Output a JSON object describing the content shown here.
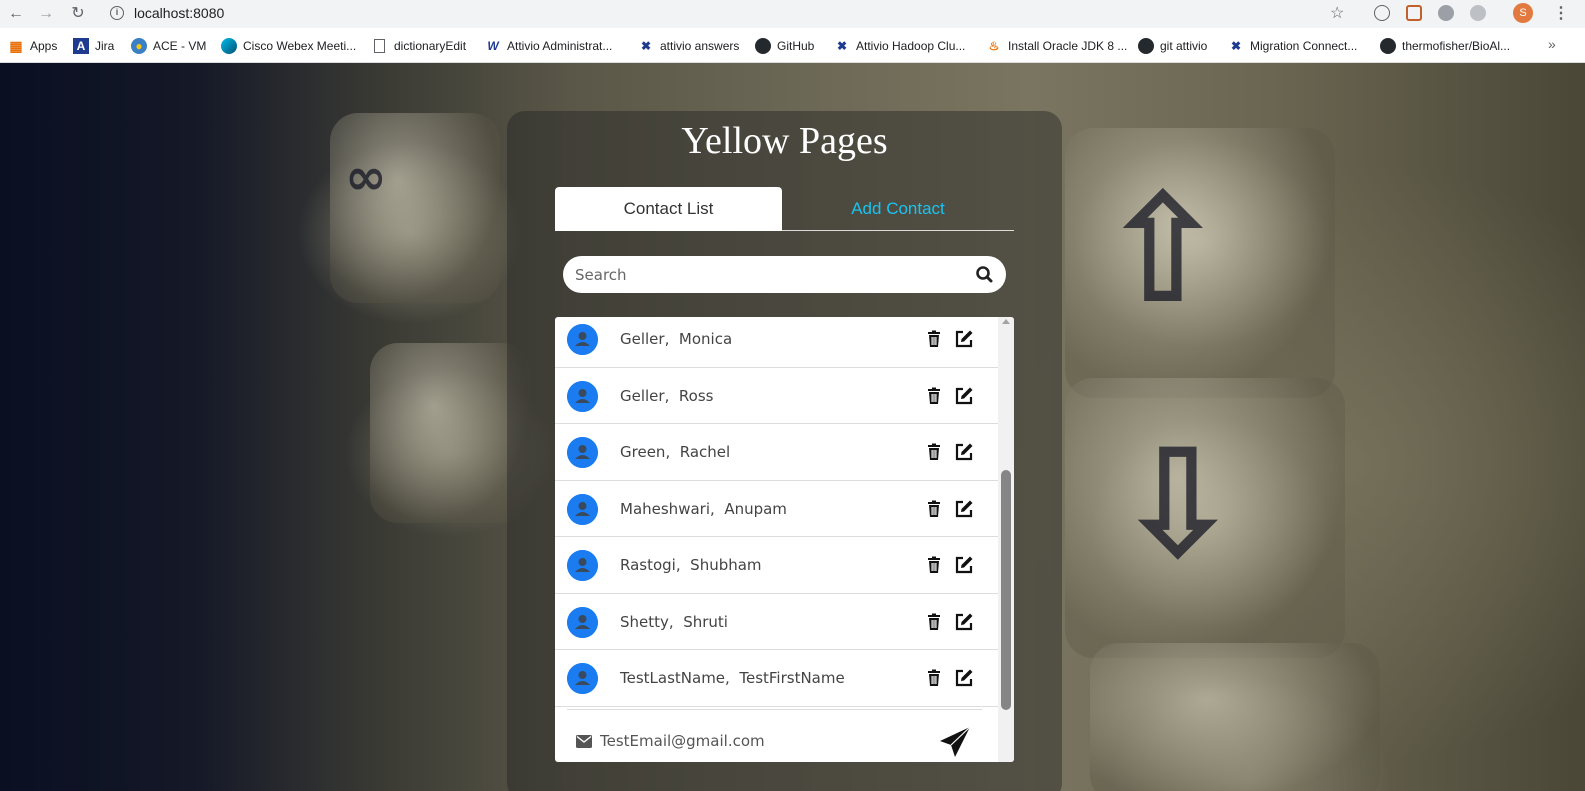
{
  "browser": {
    "url": "localhost:8080",
    "profile_initial": "S",
    "bookmarks": [
      {
        "label": "Apps",
        "icon": "apps-grid-icon"
      },
      {
        "label": "Jira",
        "icon": "jira-icon"
      },
      {
        "label": "ACE - VM",
        "icon": "globe-icon"
      },
      {
        "label": "Cisco Webex Meeti...",
        "icon": "webex-icon"
      },
      {
        "label": "dictionaryEdit",
        "icon": "page-icon"
      },
      {
        "label": "Attivio Administrat...",
        "icon": "attivio-w-icon"
      },
      {
        "label": "attivio answers",
        "icon": "attivio-x-icon"
      },
      {
        "label": "GitHub",
        "icon": "github-icon"
      },
      {
        "label": "Attivio Hadoop Clu...",
        "icon": "attivio-x-icon"
      },
      {
        "label": "Install Oracle JDK 8 ...",
        "icon": "java-icon"
      },
      {
        "label": "git attivio",
        "icon": "github-icon"
      },
      {
        "label": "Migration Connect...",
        "icon": "attivio-x-icon"
      },
      {
        "label": "thermofisher/BioAl...",
        "icon": "github-icon"
      }
    ]
  },
  "app": {
    "title": "Yellow Pages",
    "tabs": [
      {
        "label": "Contact List",
        "active": true
      },
      {
        "label": "Add Contact",
        "active": false
      }
    ],
    "search": {
      "placeholder": "Search",
      "value": ""
    },
    "contacts": [
      {
        "last": "Geller",
        "first": "Monica"
      },
      {
        "last": "Geller",
        "first": "Ross"
      },
      {
        "last": "Green",
        "first": "Rachel"
      },
      {
        "last": "Maheshwari",
        "first": "Anupam"
      },
      {
        "last": "Rastogi",
        "first": "Shubham"
      },
      {
        "last": "Shetty",
        "first": "Shruti"
      },
      {
        "last": "TestLastName",
        "first": "TestFirstName"
      }
    ],
    "expanded_contact": {
      "email": "TestEmail@gmail.com"
    }
  },
  "colors": {
    "tab_link": "#19c3f0",
    "avatar": "#1a7cf0",
    "card_overlay": "rgba(35,35,35,0.45)"
  }
}
